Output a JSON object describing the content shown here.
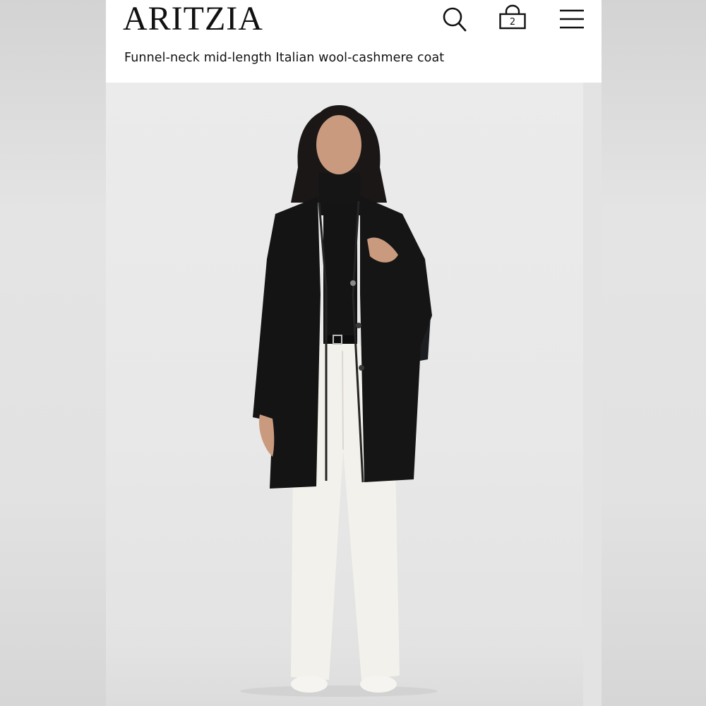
{
  "brand": {
    "logo_text": "ARITZIA"
  },
  "header": {
    "search_icon": "search-icon",
    "bag_icon": "shopping-bag-icon",
    "bag_count": "2",
    "menu_icon": "hamburger-menu-icon"
  },
  "product": {
    "title": "Funnel-neck mid-length Italian wool-cashmere coat"
  },
  "colors": {
    "background": "#ffffff",
    "text": "#111111",
    "photo_backdrop": "#e8e8e8",
    "coat": "#141414",
    "trousers": "#f3f1ec"
  }
}
